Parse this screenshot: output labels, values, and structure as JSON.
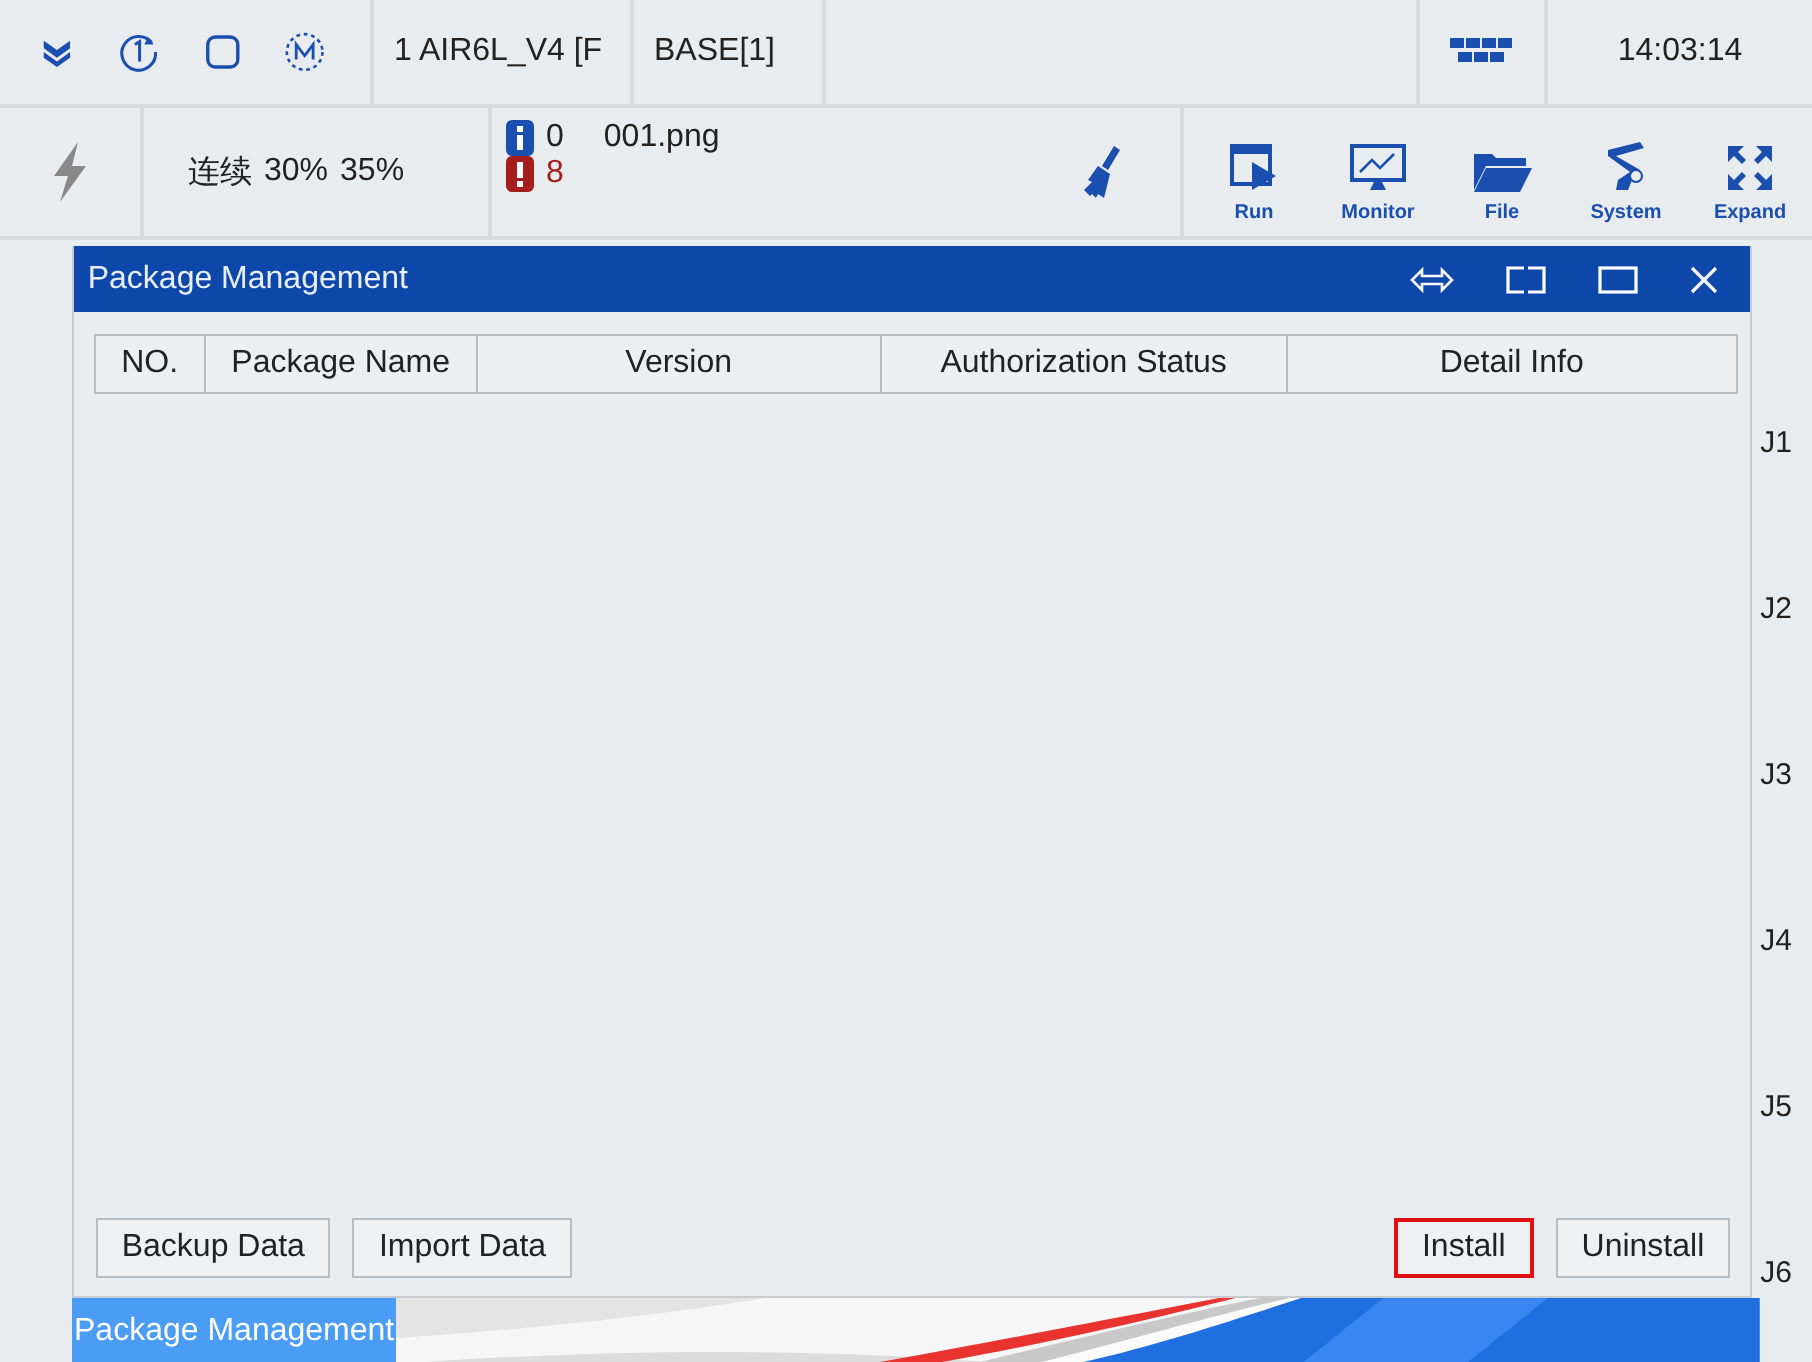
{
  "status_bar": {
    "robot": "1 AIR6L_V4 [F",
    "coordinate": "BASE[1]",
    "time": "14:03:14"
  },
  "toolbar": {
    "mode": "连续",
    "speed_1": "30%",
    "speed_2": "35%",
    "info_count": "0",
    "error_count": "8",
    "file": "001.png",
    "buttons": [
      {
        "label": "Run",
        "kind": "run"
      },
      {
        "label": "Monitor",
        "kind": "monitor"
      },
      {
        "label": "File",
        "kind": "file"
      },
      {
        "label": "System",
        "kind": "system"
      },
      {
        "label": "Expand",
        "kind": "expand"
      }
    ]
  },
  "dialog": {
    "title": "Package Management",
    "columns": [
      "NO.",
      "Package Name",
      "Version",
      "Authorization Status",
      "Detail Info"
    ],
    "buttons": [
      {
        "label": "Backup Data",
        "highlighted": false
      },
      {
        "label": "Import Data",
        "highlighted": false
      },
      {
        "label": "Install",
        "highlighted": true
      },
      {
        "label": "Uninstall",
        "highlighted": false
      }
    ]
  },
  "joints": [
    "J1",
    "J2",
    "J3",
    "J4",
    "J5",
    "J6"
  ],
  "taskbar": {
    "tabs": [
      {
        "label": "Package Management",
        "selected": true
      }
    ]
  }
}
